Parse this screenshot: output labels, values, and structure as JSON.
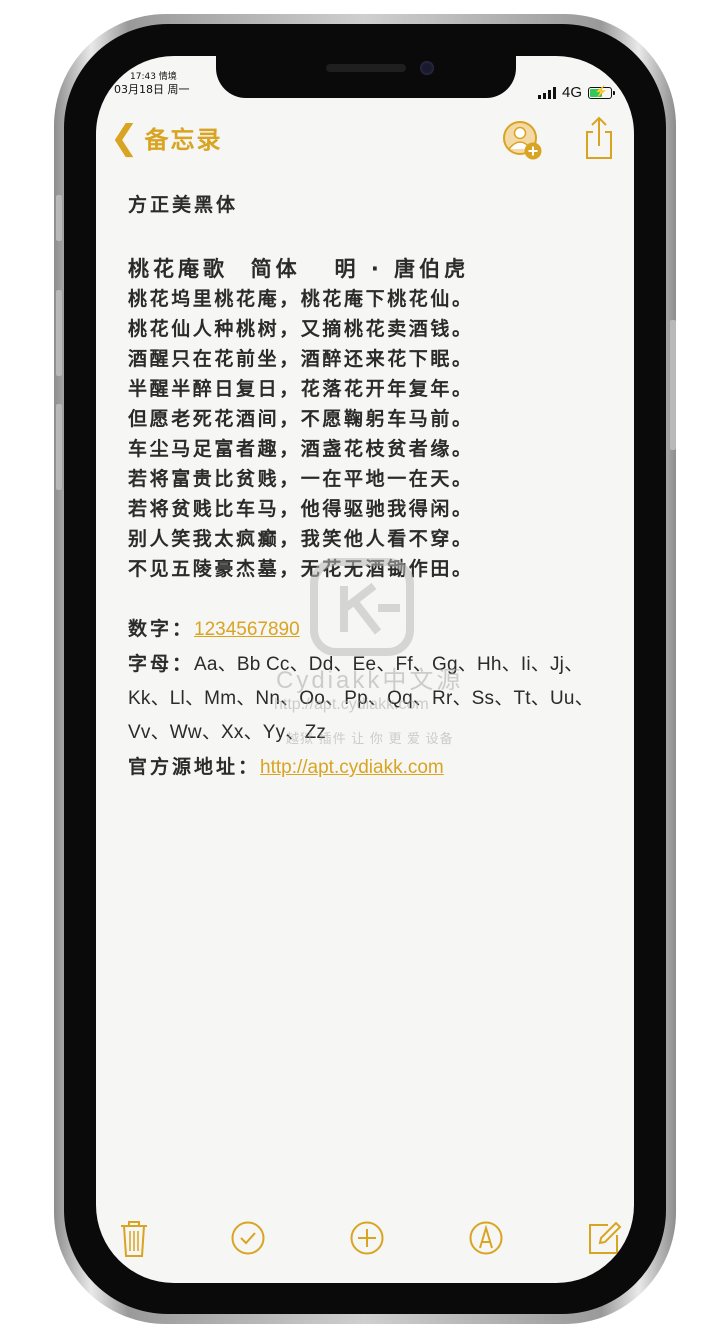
{
  "status_bar": {
    "time": "17:43 情境",
    "date": "03月18日 周一",
    "network": "4G"
  },
  "nav": {
    "back_label": "备忘录",
    "add_person_icon": "person-add-icon",
    "share_icon": "share-icon"
  },
  "note": {
    "font_name": "方正美黑体",
    "poem_title": "桃花庵歌  简体   明 · 唐伯虎",
    "poem_lines": [
      "桃花坞里桃花庵，桃花庵下桃花仙。",
      "桃花仙人种桃树，又摘桃花卖酒钱。",
      "酒醒只在花前坐，酒醉还来花下眠。",
      "半醒半醉日复日，花落花开年复年。",
      "但愿老死花酒间，不愿鞠躬车马前。",
      "车尘马足富者趣，酒盏花枝贫者缘。",
      "若将富贵比贫贱，一在平地一在天。",
      "若将贫贱比车马，他得驱驰我得闲。",
      "别人笑我太疯癫，我笑他人看不穿。",
      "不见五陵豪杰墓，无花无酒锄作田。"
    ],
    "digits_label": "数字：",
    "digits_value": "1234567890",
    "letters_label": "字母：",
    "letters_value": "Aa、Bb Cc、Dd、Ee、Ff、Gg、Hh、Ii、Jj、Kk、Ll、Mm、Nn、Oo、Pp、Qq、Rr、Ss、Tt、Uu、Vv、Ww、Xx、Yy、Zz",
    "source_label": "官方源地址：",
    "source_url": "http://apt.cydiakk.com"
  },
  "watermark": {
    "brand": "Cydiakk中文源",
    "url": "http://apt.cydiakk.com",
    "slogan": "越狱 插件 让 你 更 爱 设备"
  },
  "toolbar": {
    "items": [
      "trash-icon",
      "checklist-icon",
      "add-icon",
      "markup-icon",
      "compose-icon"
    ]
  },
  "colors": {
    "accent": "#d9a421",
    "text": "#2b2b2b",
    "paper": "#f6f6f4"
  }
}
